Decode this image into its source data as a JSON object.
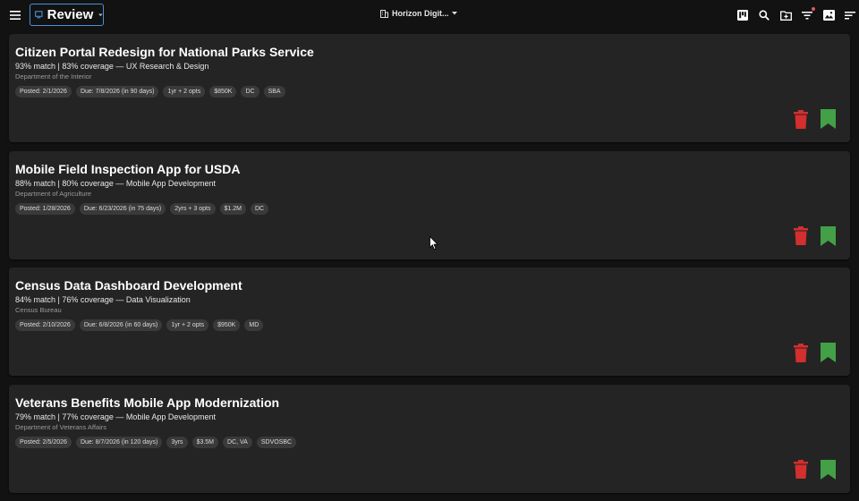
{
  "header": {
    "view_label": "Review",
    "org_label": "Horizon Digit...",
    "icons": [
      "menu-icon",
      "view-select-icon",
      "chevron-down-icon",
      "building-icon",
      "kanban-icon",
      "search-icon",
      "folder-plus-icon",
      "filter-icon",
      "image-icon",
      "sort-icon"
    ],
    "accent": "#4a90d9"
  },
  "opportunities": [
    {
      "title": "Citizen Portal Redesign for National Parks Service",
      "match": "93% match | 83% coverage — UX Research & Design",
      "agency": "Department of the Interior",
      "chips": [
        "Posted: 2/1/2026",
        "Due: 7/8/2026 (in 90 days)",
        "1yr + 2 opts",
        "$850K",
        "DC",
        "SBA"
      ]
    },
    {
      "title": "Mobile Field Inspection App for USDA",
      "match": "88% match | 80% coverage — Mobile App Development",
      "agency": "Department of Agriculture",
      "chips": [
        "Posted: 1/28/2026",
        "Due: 6/23/2026 (in 75 days)",
        "2yrs + 3 opts",
        "$1.2M",
        "DC"
      ]
    },
    {
      "title": "Census Data Dashboard Development",
      "match": "84% match | 76% coverage — Data Visualization",
      "agency": "Census Bureau",
      "chips": [
        "Posted: 2/10/2026",
        "Due: 6/8/2026 (in 60 days)",
        "1yr + 2 opts",
        "$950K",
        "MD"
      ]
    },
    {
      "title": "Veterans Benefits Mobile App Modernization",
      "match": "79% match | 77% coverage — Mobile App Development",
      "agency": "Department of Veterans Affairs",
      "chips": [
        "Posted: 2/5/2026",
        "Due: 8/7/2026 (in 120 days)",
        "3yrs",
        "$3.5M",
        "DC, VA",
        "SDVOSBC"
      ]
    }
  ],
  "colors": {
    "delete": "#d32f2f",
    "bookmark": "#43a047",
    "card_bg": "#242424",
    "page_bg": "#121212"
  }
}
